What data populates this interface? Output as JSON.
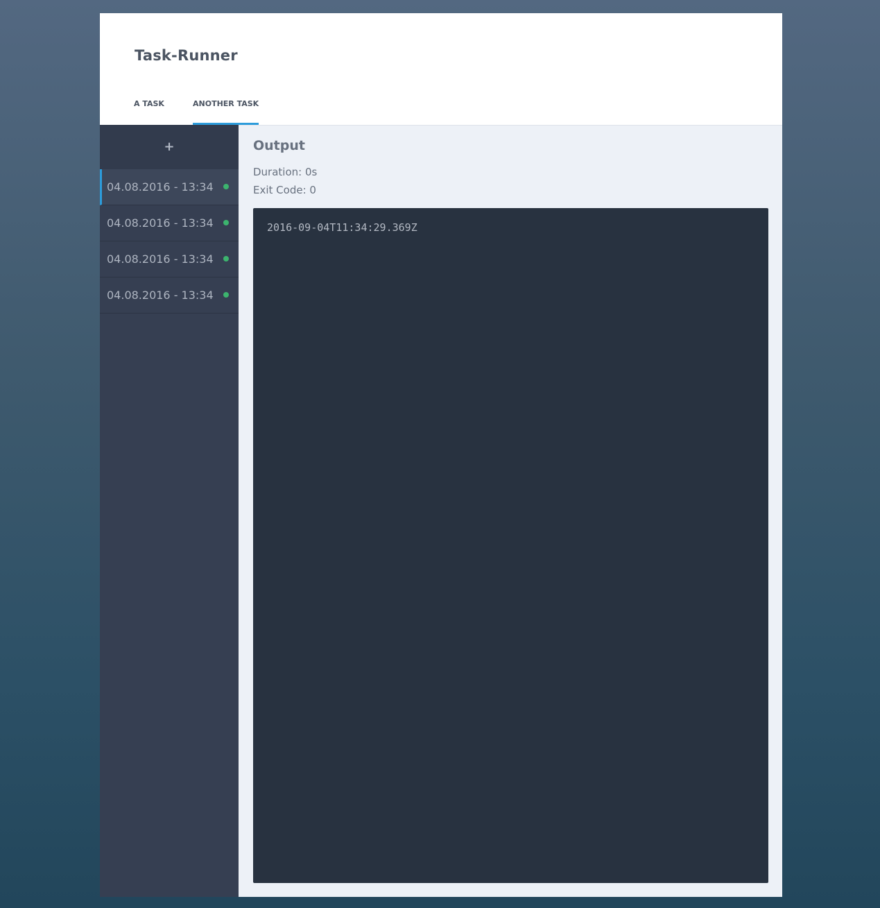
{
  "app": {
    "title": "Task-Runner"
  },
  "tabs": [
    {
      "label": "A TASK",
      "active": false
    },
    {
      "label": "ANOTHER TASK",
      "active": true
    }
  ],
  "sidebar": {
    "add_label": "+",
    "runs": [
      {
        "label": "04.08.2016 - 13:34",
        "status": "success",
        "active": true
      },
      {
        "label": "04.08.2016 - 13:34",
        "status": "success",
        "active": false
      },
      {
        "label": "04.08.2016 - 13:34",
        "status": "success",
        "active": false
      },
      {
        "label": "04.08.2016 - 13:34",
        "status": "success",
        "active": false
      }
    ]
  },
  "output": {
    "title": "Output",
    "duration_label": "Duration:",
    "duration_value": "0s",
    "exit_code_label": "Exit Code:",
    "exit_code_value": "0",
    "console_lines": [
      "2016-09-04T11:34:29.369Z"
    ]
  },
  "colors": {
    "accent": "#2d9cdb",
    "status_success": "#3cb46e",
    "sidebar_bg": "#363f52",
    "console_bg": "#283240"
  }
}
